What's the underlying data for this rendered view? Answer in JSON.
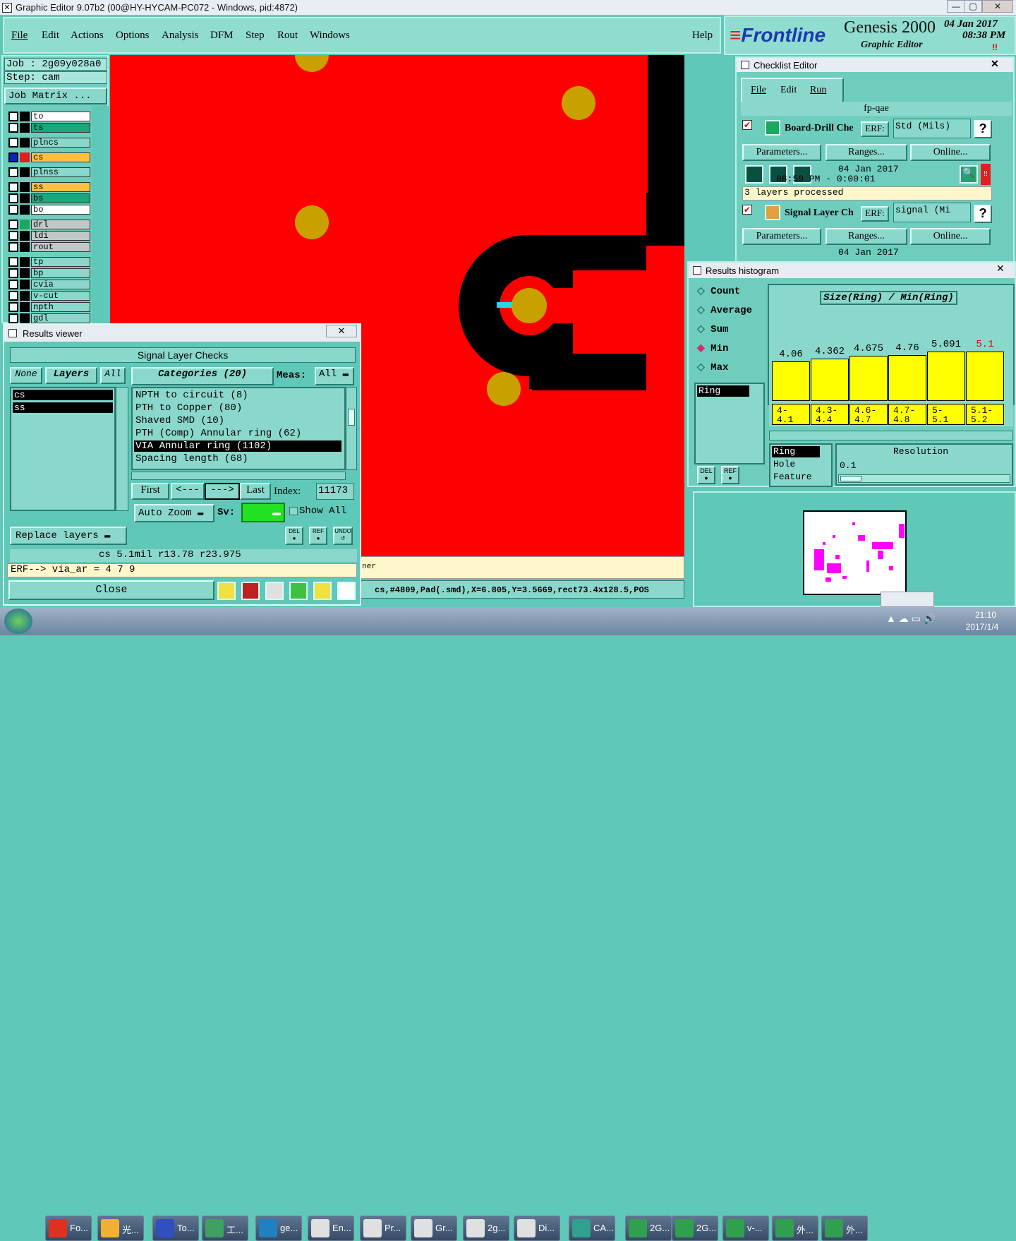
{
  "window": {
    "title": "Graphic Editor 9.07b2 (00@HY-HYCAM-PC072 - Windows, pid:4872)"
  },
  "menu": [
    "File",
    "Edit",
    "Actions",
    "Options",
    "Analysis",
    "DFM",
    "Step",
    "Rout",
    "Windows"
  ],
  "help": "Help",
  "logo": {
    "brand": "Frontline",
    "product": "Genesis 2000",
    "subtitle": "Graphic Editor",
    "date": "04 Jan 2017",
    "time": "08:38 PM",
    "alert": "!!"
  },
  "job": {
    "job": "Job  : 2g09y028a0",
    "step": "Step: cam",
    "matrix": "Job Matrix ..."
  },
  "layers": [
    {
      "name": "to",
      "color": "#ffffff"
    },
    {
      "name": "ts",
      "color": "#1aa87a"
    },
    {
      "name": "plncs",
      "color": "#8ad8cb"
    },
    {
      "name": "cs",
      "color": "#ffc040"
    },
    {
      "name": "plnss",
      "color": "#8ad8cb"
    },
    {
      "name": "ss",
      "color": "#ffc040"
    },
    {
      "name": "bs",
      "color": "#1aa87a"
    },
    {
      "name": "bo",
      "color": "#ffffff"
    },
    {
      "name": "drl",
      "color": "#c0c8c8"
    },
    {
      "name": "ldi",
      "color": "#c0c8c8"
    },
    {
      "name": "rout",
      "color": "#c0c8c8"
    },
    {
      "name": "tp",
      "color": "#8ad8cb"
    },
    {
      "name": "bp",
      "color": "#8ad8cb"
    },
    {
      "name": "cvia",
      "color": "#8ad8cb"
    },
    {
      "name": "v-cut",
      "color": "#8ad8cb"
    },
    {
      "name": "npth",
      "color": "#8ad8cb"
    },
    {
      "name": "gdl",
      "color": "#8ad8cb"
    }
  ],
  "status": {
    "line1": "ner",
    "line2": "cs,#4809,Pad(.smd),X=6.805,Y=3.5669,rect73.4x128.5,POS"
  },
  "checklist": {
    "title": "Checklist Editor",
    "menu": [
      "File",
      "Edit",
      "Run"
    ],
    "name": "fp-qae",
    "items": [
      {
        "name": "Board-Drill Che",
        "erf_label": "ERF:",
        "erf": "Std (Mils)",
        "date": "04 Jan 2017",
        "time": "08:59 PM - 0:00:01",
        "msg": "3 layers processed"
      },
      {
        "name": "Signal Layer Ch",
        "erf_label": "ERF:",
        "erf": "signal (Mi",
        "date": "04 Jan 2017",
        "time": "",
        "msg": ""
      }
    ],
    "buttons": {
      "params": "Parameters...",
      "ranges": "Ranges...",
      "online": "Online..."
    },
    "question": "?"
  },
  "histogram": {
    "title": "Results histogram",
    "modes": [
      "Count",
      "Average",
      "Sum",
      "Min",
      "Max"
    ],
    "selected_mode": "Min",
    "attr_list": [
      "Ring"
    ],
    "chart_title": "Size(Ring) / Min(Ring)",
    "bars": [
      {
        "value": "4.06",
        "bin": "4-\n4.1",
        "red": false,
        "frac": 0.8
      },
      {
        "value": "4.362",
        "bin": "4.3-\n4.4",
        "red": false,
        "frac": 0.86
      },
      {
        "value": "4.675",
        "bin": "4.6-\n4.7",
        "red": false,
        "frac": 0.92
      },
      {
        "value": "4.76",
        "bin": "4.7-\n4.8",
        "red": false,
        "frac": 0.93
      },
      {
        "value": "5.091",
        "bin": "5-\n5.1",
        "red": false,
        "frac": 1.0
      },
      {
        "value": "5.1",
        "bin": "5.1-\n5.2",
        "red": true,
        "frac": 1.0
      }
    ],
    "params": [
      "Ring",
      "Hole",
      "Feature"
    ],
    "resolution_label": "Resolution",
    "resolution": "0.1",
    "del": "DEL",
    "ref": "REF"
  },
  "results": {
    "title": "Results viewer",
    "header": "Signal Layer Checks",
    "none": "None",
    "layers": "Layers",
    "all": "All",
    "categories": "Categories (20)",
    "meas_label": "Meas:",
    "meas": "All",
    "layer_list": [
      "cs",
      "ss"
    ],
    "cat_list": [
      "NPTH to circuit (8)",
      "PTH to Copper (80)",
      "Shaved SMD (10)",
      "PTH (Comp) Annular ring (62)",
      "VIA Annular ring (1102)",
      "Spacing length (68)"
    ],
    "selected_cat": "VIA Annular ring (1102)",
    "nav": {
      "first": "First",
      "prev": "<---",
      "next": "--->",
      "last": "Last",
      "index_label": "Index:",
      "index": "11173"
    },
    "autozoom": "Auto Zoom",
    "sv": "Sv:",
    "show_all": "Show All",
    "replace": "Replace layers",
    "del": "DEL",
    "ref": "REF",
    "undo": "UNDO",
    "info": "cs 5.1mil  r13.78  r23.975",
    "erf": "ERF--> via_ar = 4 7 9",
    "close": "Close"
  },
  "taskbar": {
    "items": [
      "Fo...",
      "光...",
      "To...",
      "工...",
      "ge...",
      "En...",
      "Pr...",
      "Gr...",
      "2g...",
      "Di...",
      "CA...",
      "2G...",
      "2G...",
      "v-...",
      "外...",
      "外..."
    ],
    "time": "21:10",
    "date": "2017/1/4"
  }
}
